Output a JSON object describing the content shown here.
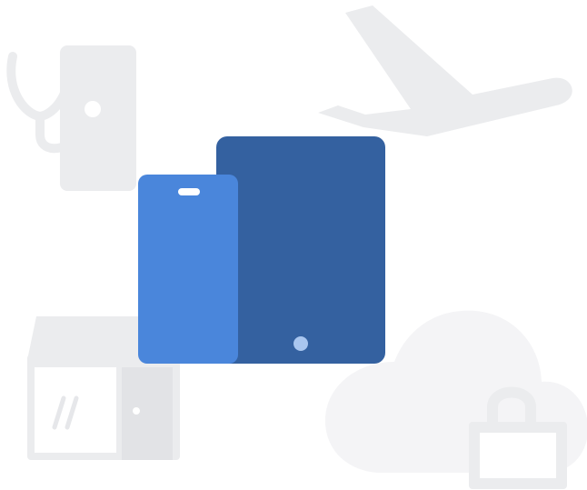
{
  "illustration": {
    "colors": {
      "background": "#ffffff",
      "background_icon": "#ebecee",
      "background_icon_light": "#f4f4f6",
      "phone": "#4a86db",
      "tablet": "#3461a0",
      "tablet_button": "#a9c6ef",
      "phone_speaker": "#ffffff"
    },
    "background_icons": [
      "stethoscope-icon",
      "airplane-icon",
      "storefront-icon",
      "cloud-icon",
      "lock-icon"
    ],
    "foreground_devices": [
      "smartphone-icon",
      "tablet-icon"
    ]
  }
}
